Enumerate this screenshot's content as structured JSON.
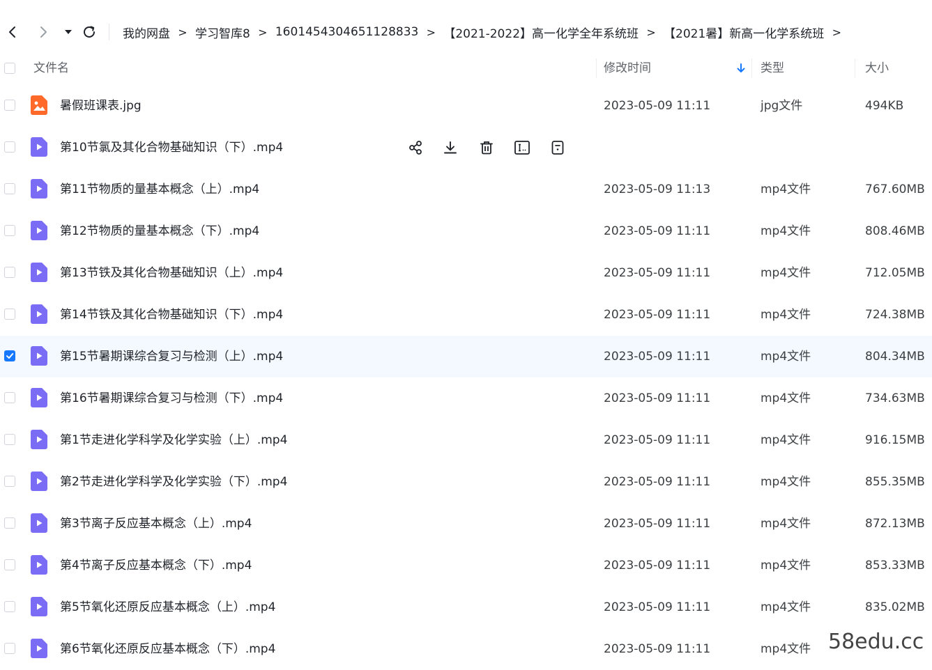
{
  "nav": {
    "back_icon": "chevron-left-icon",
    "forward_icon": "chevron-right-icon",
    "dropdown_icon": "caret-down-icon",
    "refresh_icon": "refresh-icon"
  },
  "breadcrumb": [
    {
      "label": "我的网盘"
    },
    {
      "label": "学习智库8"
    },
    {
      "label": "1601454304651128833"
    },
    {
      "label": "【2021-2022】高一化学全年系统班"
    },
    {
      "label": "【2021暑】新高一化学系统班"
    }
  ],
  "breadcrumb_separator": ">",
  "header": {
    "name": "文件名",
    "modified": "修改时间",
    "type": "类型",
    "size": "大小",
    "sort_icon": "arrow-down-icon"
  },
  "files": [
    {
      "name": "暑假班课表.jpg",
      "date": "2023-05-09 11:11",
      "type": "jpg文件",
      "size": "494KB",
      "icon": "image-file-icon",
      "checked": false
    },
    {
      "name": "第10节氯及其化合物基础知识（下）.mp4",
      "date": "",
      "type": "",
      "size": "",
      "icon": "video-file-icon",
      "checked": false,
      "hovered": true
    },
    {
      "name": "第11节物质的量基本概念（上）.mp4",
      "date": "2023-05-09 11:13",
      "type": "mp4文件",
      "size": "767.60MB",
      "icon": "video-file-icon",
      "checked": false
    },
    {
      "name": "第12节物质的量基本概念（下）.mp4",
      "date": "2023-05-09 11:11",
      "type": "mp4文件",
      "size": "808.46MB",
      "icon": "video-file-icon",
      "checked": false
    },
    {
      "name": "第13节铁及其化合物基础知识（上）.mp4",
      "date": "2023-05-09 11:11",
      "type": "mp4文件",
      "size": "712.05MB",
      "icon": "video-file-icon",
      "checked": false
    },
    {
      "name": "第14节铁及其化合物基础知识（下）.mp4",
      "date": "2023-05-09 11:11",
      "type": "mp4文件",
      "size": "724.38MB",
      "icon": "video-file-icon",
      "checked": false
    },
    {
      "name": "第15节暑期课综合复习与检测（上）.mp4",
      "date": "2023-05-09 11:11",
      "type": "mp4文件",
      "size": "804.34MB",
      "icon": "video-file-icon",
      "checked": true
    },
    {
      "name": "第16节暑期课综合复习与检测（下）.mp4",
      "date": "2023-05-09 11:11",
      "type": "mp4文件",
      "size": "734.63MB",
      "icon": "video-file-icon",
      "checked": false
    },
    {
      "name": "第1节走进化学科学及化学实验（上）.mp4",
      "date": "2023-05-09 11:11",
      "type": "mp4文件",
      "size": "916.15MB",
      "icon": "video-file-icon",
      "checked": false
    },
    {
      "name": "第2节走进化学科学及化学实验（下）.mp4",
      "date": "2023-05-09 11:11",
      "type": "mp4文件",
      "size": "855.35MB",
      "icon": "video-file-icon",
      "checked": false
    },
    {
      "name": "第3节离子反应基本概念（上）.mp4",
      "date": "2023-05-09 11:11",
      "type": "mp4文件",
      "size": "872.13MB",
      "icon": "video-file-icon",
      "checked": false
    },
    {
      "name": "第4节离子反应基本概念（下）.mp4",
      "date": "2023-05-09 11:11",
      "type": "mp4文件",
      "size": "853.33MB",
      "icon": "video-file-icon",
      "checked": false
    },
    {
      "name": "第5节氧化还原反应基本概念（上）.mp4",
      "date": "2023-05-09 11:11",
      "type": "mp4文件",
      "size": "835.02MB",
      "icon": "video-file-icon",
      "checked": false
    },
    {
      "name": "第6节氧化还原反应基本概念（下）.mp4",
      "date": "2023-05-09 11:11",
      "type": "mp4文件",
      "size": "",
      "icon": "video-file-icon",
      "checked": false
    }
  ],
  "row_actions": [
    {
      "icon": "share-icon"
    },
    {
      "icon": "download-icon"
    },
    {
      "icon": "delete-icon"
    },
    {
      "icon": "rename-icon"
    },
    {
      "icon": "more-icon"
    }
  ],
  "watermark": "58edu.cc",
  "colors": {
    "accent": "#1677ff",
    "image_icon": "#ff6a2b",
    "video_icon": "#7b6cf6",
    "selected_row_bg": "#f4f9ff"
  }
}
